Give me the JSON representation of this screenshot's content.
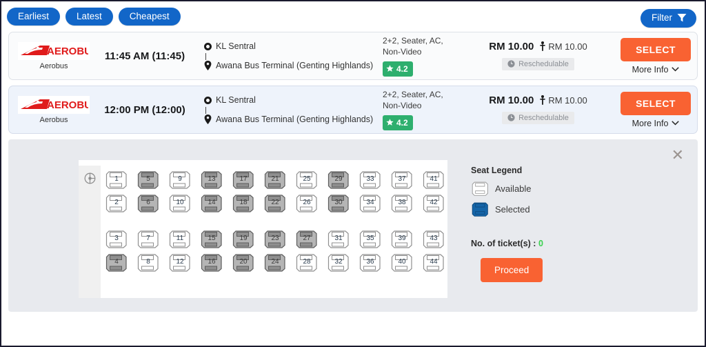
{
  "toolbar": {
    "sort_options": [
      {
        "label": "Earliest",
        "name": "sort-earliest"
      },
      {
        "label": "Latest",
        "name": "sort-latest"
      },
      {
        "label": "Cheapest",
        "name": "sort-cheapest"
      }
    ],
    "filter_label": "Filter",
    "accent_blue": "#1266c8"
  },
  "buses": [
    {
      "operator": "Aerobus",
      "logo_text": "AEROBUS",
      "departure": "11:45 AM (11:45)",
      "origin": "KL Sentral",
      "destination": "Awana Bus Terminal (Genting Highlands)",
      "bus_type": "2+2, Seater, AC, Non-Video",
      "rating": "4.2",
      "price": "RM 10.00",
      "price_per_pax": "RM 10.00",
      "reschedulable": "Reschedulable",
      "select_label": "SELECT",
      "more_info_label": "More Info",
      "selected": false
    },
    {
      "operator": "Aerobus",
      "logo_text": "AEROBUS",
      "departure": "12:00 PM (12:00)",
      "origin": "KL Sentral",
      "destination": "Awana Bus Terminal (Genting Highlands)",
      "bus_type": "2+2, Seater, AC, Non-Video",
      "rating": "4.2",
      "price": "RM 10.00",
      "price_per_pax": "RM 10.00",
      "reschedulable": "Reschedulable",
      "select_label": "SELECT",
      "more_info_label": "More Info",
      "selected": true
    }
  ],
  "seat_panel": {
    "close_label": "✕",
    "driver_icon": "steering-wheel-icon",
    "rows": [
      [
        "1",
        "5",
        "9",
        "13",
        "17",
        "21",
        "25",
        "29",
        "33",
        "37",
        "41"
      ],
      [
        "2",
        "6",
        "10",
        "14",
        "18",
        "22",
        "26",
        "30",
        "34",
        "38",
        "42"
      ],
      [
        "3",
        "7",
        "11",
        "15",
        "19",
        "23",
        "27",
        "31",
        "35",
        "39",
        "43"
      ],
      [
        "4",
        "8",
        "12",
        "16",
        "20",
        "24",
        "28",
        "32",
        "36",
        "40",
        "44"
      ]
    ],
    "occupied": [
      "4",
      "5",
      "6",
      "13",
      "14",
      "15",
      "16",
      "17",
      "18",
      "19",
      "20",
      "21",
      "22",
      "23",
      "24",
      "27",
      "29",
      "30"
    ],
    "legend": {
      "title": "Seat Legend",
      "available_label": "Available",
      "selected_label": "Selected",
      "selected_color": "#1565a8",
      "available_color": "#ffffff"
    },
    "ticket_count_label": "No. of ticket(s) :",
    "ticket_count": "0",
    "proceed_label": "Proceed",
    "proceed_color": "#f96232"
  }
}
